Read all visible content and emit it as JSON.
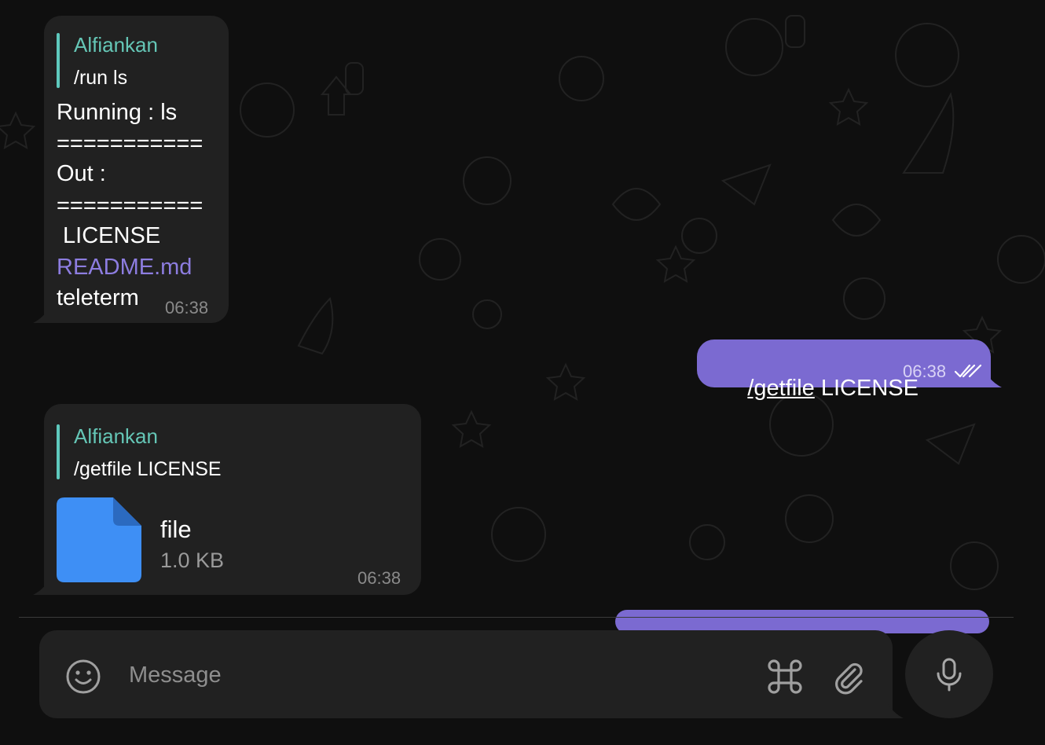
{
  "colors": {
    "background": "#0f0f0f",
    "incoming_bubble": "#212121",
    "outgoing_bubble": "#7b6ad1",
    "reply_accent": "#5ec9bd",
    "link": "#8d7de0",
    "file_icon": "#3e8ff5",
    "timestamp": "#8a8a8a"
  },
  "messages": [
    {
      "direction": "incoming",
      "reply": {
        "name": "Alfiankan",
        "text": "/run ls"
      },
      "lines": [
        "Running : ls",
        "===========",
        "Out :",
        "===========",
        " LICENSE",
        "README.md",
        "teleterm"
      ],
      "time": "06:38"
    },
    {
      "direction": "outgoing",
      "command": "/getfile",
      "text": " LICENSE",
      "time": "06:38",
      "status_icon": "double-check-icon"
    },
    {
      "direction": "incoming",
      "reply": {
        "name": "Alfiankan",
        "text": "/getfile LICENSE"
      },
      "file": {
        "name": "file",
        "size": "1.0 KB",
        "icon": "document-icon"
      },
      "time": "06:38"
    }
  ],
  "composer": {
    "placeholder": "Message",
    "emoji_icon": "smiley-icon",
    "command_icon": "command-icon",
    "attach_icon": "paperclip-icon",
    "mic_icon": "microphone-icon"
  }
}
